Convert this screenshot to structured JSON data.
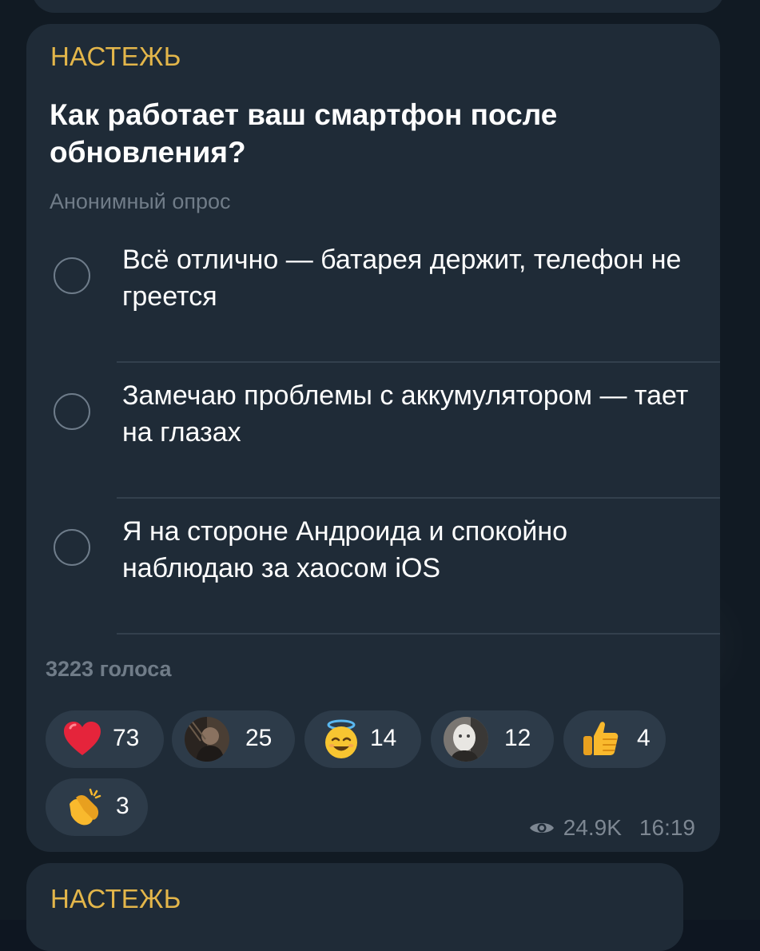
{
  "post": {
    "channel": "НАСТЕЖЬ",
    "question": "Как работает ваш смартфон после обновления?",
    "poll_type": "Анонимный опрос",
    "options": [
      {
        "text": "Всё отлично — батарея держит, телефон не греется"
      },
      {
        "text": "Замечаю проблемы с аккумулятором — тает на глазах"
      },
      {
        "text": "Я на стороне Андроида и спокойно наблюдаю за хаосом iOS"
      }
    ],
    "votes_label": "3223 голоса",
    "reactions": [
      {
        "icon": "heart-emoji",
        "count": "73"
      },
      {
        "icon": "user-avatar-dark",
        "count": "25"
      },
      {
        "icon": "angel-smiley-emoji",
        "count": "14"
      },
      {
        "icon": "user-avatar-light",
        "count": "12"
      },
      {
        "icon": "thumbs-up-emoji",
        "count": "4"
      },
      {
        "icon": "clapping-hands-emoji",
        "count": "3"
      }
    ],
    "views": "24.9K",
    "time": "16:19"
  },
  "next_post": {
    "channel": "НАСТЕЖЬ"
  },
  "colors": {
    "accent": "#e3b64a",
    "bubble": "#1f2b37",
    "reaction_bg": "#2d3b49"
  }
}
